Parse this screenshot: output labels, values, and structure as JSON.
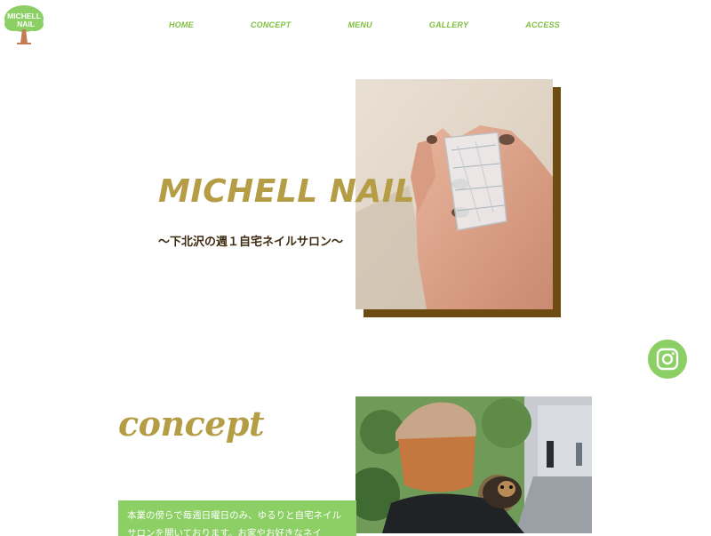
{
  "logo": {
    "line1": "MICHELL",
    "line2": "NAIL"
  },
  "nav": {
    "items": [
      "HOME",
      "CONCEPT",
      "MENU",
      "GALLERY",
      "ACCESS"
    ]
  },
  "hero": {
    "title": "MICHELL NAIL",
    "subtitle": "〜下北沢の週１自宅ネイルサロン〜"
  },
  "concept": {
    "title": "concept",
    "text": "本業の傍らで毎週日曜日のみ、ゆるりと自宅ネイルサロンを開いております。お家やお好きなネイ"
  },
  "icons": {
    "instagram": "instagram-icon",
    "logo_tree": "tree-icon"
  },
  "colors": {
    "accent_green": "#8ccf64",
    "nav_green": "#7fbf3f",
    "gold": "#b59d45",
    "brown_shadow": "#6e4b10"
  }
}
